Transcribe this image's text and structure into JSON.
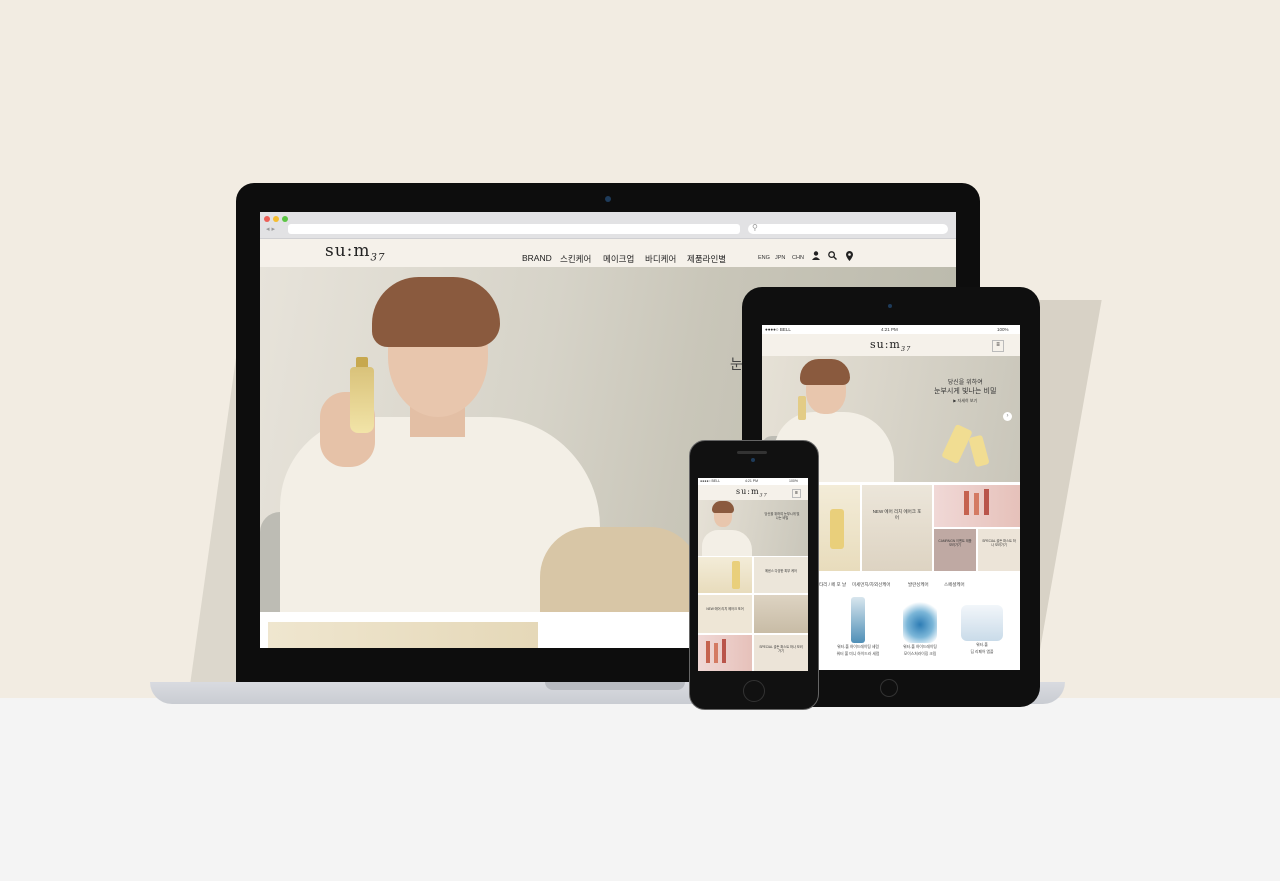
{
  "desktop": {
    "logo": "su:m",
    "logo_sub": "37",
    "menu": [
      "BRAND",
      "스킨케어",
      "메이크업",
      "바디케어",
      "제품라인별"
    ],
    "languages": [
      "ENG",
      "JPN",
      "CHN"
    ],
    "icons": [
      "user-icon",
      "search-icon",
      "location-icon"
    ],
    "hero_text": "눈"
  },
  "tablet": {
    "status": {
      "carrier": "●●●●○ BELL",
      "time": "4:21 PM",
      "battery": "100%"
    },
    "logo": "su:m",
    "logo_sub": "37",
    "hero_line1": "당신을 위하여",
    "hero_line2": "눈부시게 빛나는 비밀",
    "hero_link": "▶ 자세히 보기",
    "grid_texts": [
      "NEW 에어 리치 에어크 포어",
      "CAMPAIGN 이벤트 제품 보러가기",
      "SPECIAL 골든 퍼스트 하나 보러가기"
    ],
    "tabs": [
      "/위 / 타리 / 페 포 날",
      "미세먼지/자외선케어",
      "발란싱케어",
      "스페셜케어"
    ],
    "products": [
      {
        "name": "워터-풀 하이드레이팅 세럼",
        "line2": "워터 풀 미니 하이드라 세럼"
      },
      {
        "name": "워터-풀 하이드레이팅",
        "line2": "모이스처라이징 크림"
      },
      {
        "name": "워터-풀",
        "line2": "딥 리페어 앰플"
      }
    ]
  },
  "phone": {
    "status": {
      "carrier": "●●●●○ BELL",
      "time": "4:21 PM",
      "battery": "100%"
    },
    "logo": "su:m",
    "logo_sub": "37",
    "tile_texts": [
      "당신을 위하여 눈부시게 빛나는 비밀",
      "에센스 다양한 피부 케어",
      "NEW 에어 리치 에어크 포어",
      "CAMPAIGN 신규 제품 보러가기",
      "SPECIAL 골든 퍼스트 하나 보러가기"
    ]
  }
}
